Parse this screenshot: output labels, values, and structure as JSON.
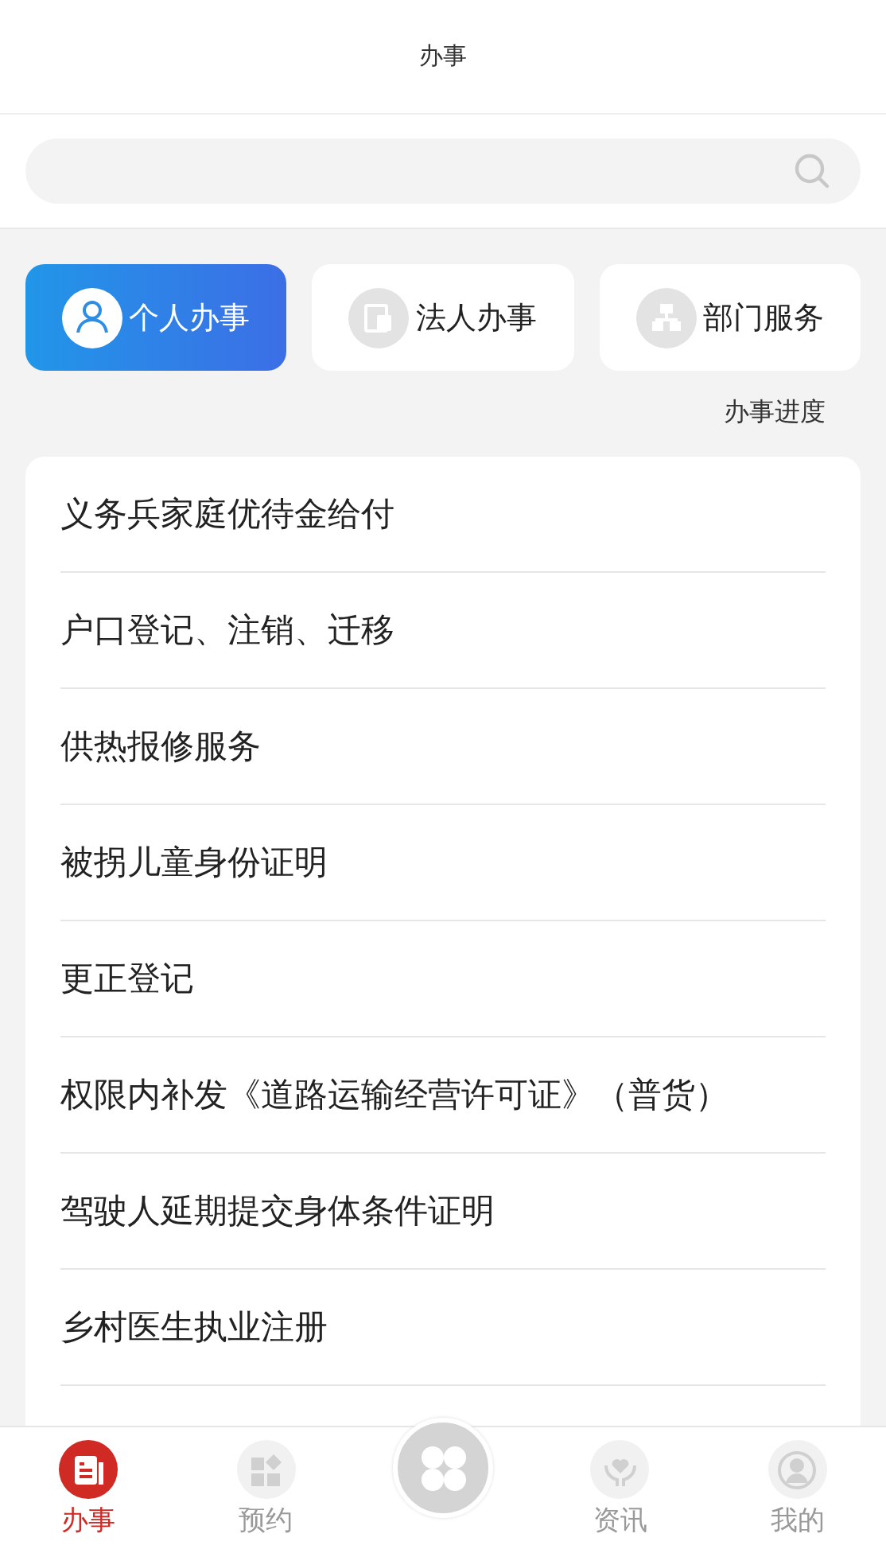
{
  "header": {
    "title": "办事"
  },
  "categories": [
    {
      "label": "个人办事",
      "kind": "person",
      "selected": true
    },
    {
      "label": "法人办事",
      "kind": "building",
      "selected": false
    },
    {
      "label": "部门服务",
      "kind": "org",
      "selected": false
    }
  ],
  "progress_link": "办事进度",
  "services": [
    "义务兵家庭优待金给付",
    "户口登记、注销、迁移",
    "供热报修服务",
    "被拐儿童身份证明",
    "更正登记",
    "权限内补发《道路运输经营许可证》（普货）",
    "驾驶人延期提交身体条件证明",
    "乡村医生执业注册"
  ],
  "tab_bar": [
    {
      "label": "办事",
      "kind": "doc",
      "selected": true
    },
    {
      "label": "预约",
      "kind": "grid",
      "selected": false
    },
    {
      "label": "资讯",
      "kind": "heart",
      "selected": false
    },
    {
      "label": "我的",
      "kind": "user",
      "selected": false
    }
  ]
}
